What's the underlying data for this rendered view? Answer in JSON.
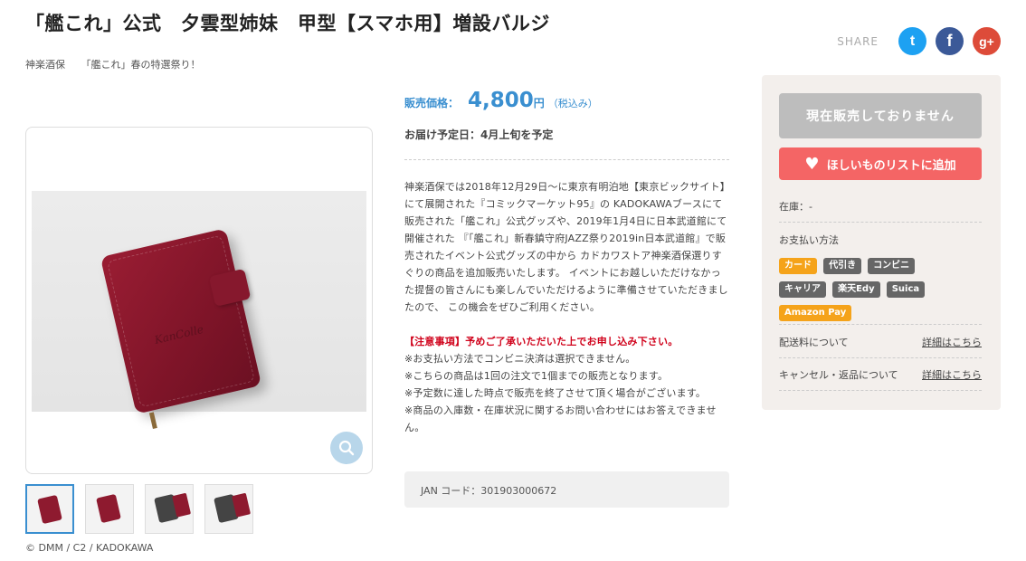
{
  "header": {
    "title": "「艦これ」公式　夕雲型姉妹　甲型【スマホ用】増設バルジ",
    "breadcrumb": [
      "神楽酒保",
      "「艦これ」春の特選祭り！"
    ]
  },
  "share": {
    "label": "SHARE",
    "twitter_icon": "t",
    "facebook_icon": "f",
    "googleplus_icon": "g+",
    "colors": {
      "twitter": "#1da1f2",
      "facebook": "#3b5998",
      "googleplus": "#dd4b39"
    }
  },
  "gallery": {
    "emboss_text": "KanColle",
    "thumbnail_count": 4,
    "copyright": "© DMM / C2 / KADOKAWA"
  },
  "product": {
    "price_label": "販売価格：",
    "price": "4,800",
    "price_unit": "円",
    "tax_note": "（税込み）",
    "delivery": "お届け予定日：4月上旬を予定",
    "description": "神楽酒保では2018年12月29日〜に東京有明泊地【東京ビックサイト】にて展開された『コミックマーケット95』の KADOKAWAブースにて販売された「艦これ」公式グッズや、2019年1月4日に日本武道館にて開催された 『「艦これ」新春鎮守府JAZZ祭り2019in日本武道館』で販売されたイベント公式グッズの中から カドカワストア神楽酒保選りすぐりの商品を追加販売いたします。 イベントにお越しいただけなかった提督の皆さんにも楽しんでいただけるように準備させていただきましたので、 この機会をぜひご利用ください。",
    "notice_title": "【注意事項】予めご了承いただいた上でお申し込み下さい。",
    "notices": [
      "※お支払い方法でコンビニ決済は選択できません。",
      "※こちらの商品は1回の注文で1個までの販売となります。",
      "※予定数に達した時点で販売を終了させて頂く場合がございます。",
      "※商品の入庫数・在庫状況に関するお問い合わせにはお答えできません。"
    ],
    "jan": "JAN コード：301903000672"
  },
  "sidebar": {
    "sold_out_label": "現在販売しておりません",
    "wishlist_label": "ほしいものリストに追加",
    "stock": "在庫：-",
    "payment_title": "お支払い方法",
    "payment_methods": [
      "カード",
      "代引き",
      "コンビニ",
      "キャリア",
      "楽天Edy",
      "Suica",
      "Amazon Pay"
    ],
    "shipping_label": "配送料について",
    "shipping_link": "詳細はこちら",
    "cancel_label": "キャンセル・返品について",
    "cancel_link": "詳細はこちら",
    "accent_color": "#f46565"
  }
}
